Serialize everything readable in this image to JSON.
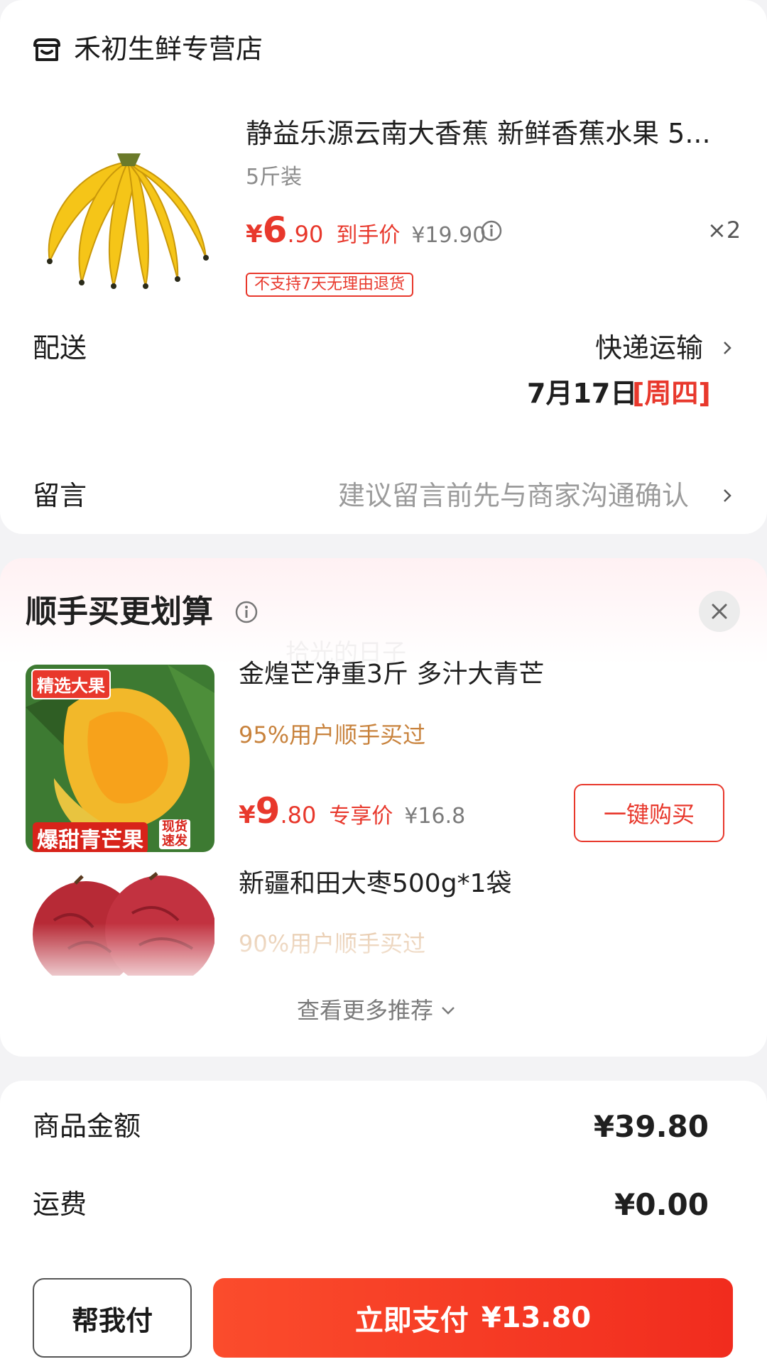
{
  "shop": {
    "name": "禾初生鲜专营店",
    "icon": "shop-icon"
  },
  "product": {
    "title": "静益乐源云南大香蕉 新鲜香蕉水果 5...",
    "spec": "5斤装",
    "price": {
      "currency": "¥",
      "int": "6",
      "dec": ".90",
      "label": "到手价",
      "original": "¥19.90"
    },
    "qty": "×2",
    "return_tag": "不支持7天无理由退货"
  },
  "delivery": {
    "label": "配送",
    "value": "快递运输",
    "date": "7月17日",
    "weekday": "[周四]"
  },
  "message": {
    "label": "留言",
    "placeholder": "建议留言前先与商家沟通确认"
  },
  "recommend": {
    "title": "顺手买更划算",
    "watermark": "拾光的日子",
    "items": [
      {
        "title": "金煌芒净重3斤 多汁大青芒",
        "bought": "95%用户顺手买过",
        "price": {
          "currency": "¥",
          "int": "9",
          "dec": ".80",
          "label": "专享价",
          "original": "¥16.8"
        },
        "button": "一键购买",
        "badges": {
          "top": "精选大果",
          "bottom": "爆甜青芒果",
          "side_1": "现货",
          "side_2": "速发"
        }
      },
      {
        "title": "新疆和田大枣500g*1袋",
        "bought": "90%用户顺手买过"
      }
    ],
    "more": "查看更多推荐"
  },
  "summary": {
    "goods_label": "商品金额",
    "goods_value": "¥39.80",
    "shipping_label": "运费",
    "shipping_value": "¥0.00"
  },
  "actions": {
    "help_pay": "帮我付",
    "pay_label": "立即支付",
    "pay_amount": "¥13.80"
  },
  "colors": {
    "accent": "#e8382c",
    "pay_button": "#f5351f",
    "bought_text": "#c8823c"
  }
}
